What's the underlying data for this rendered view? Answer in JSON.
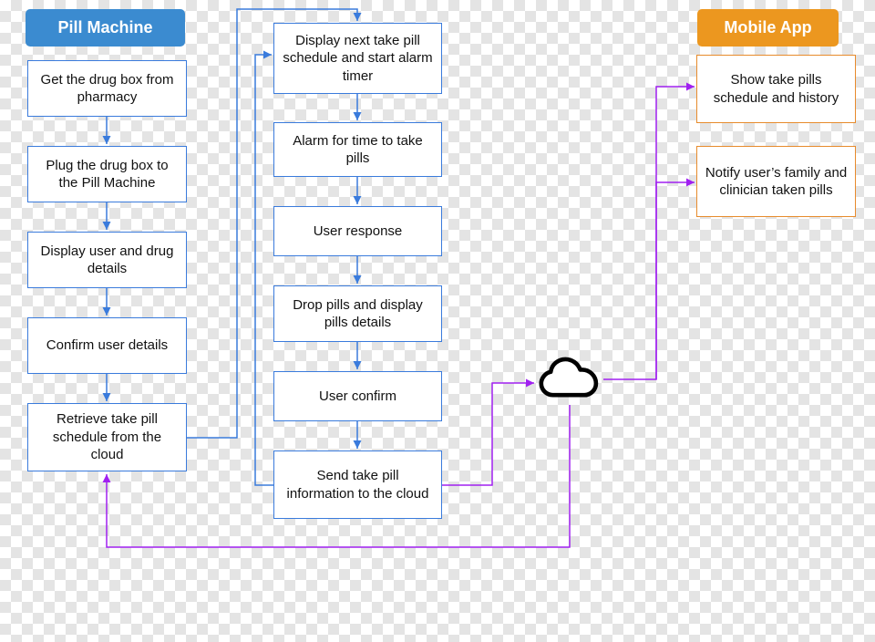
{
  "headers": {
    "pill_machine": {
      "label": "Pill Machine",
      "color": "#3b8bd0"
    },
    "mobile_app": {
      "label": "Mobile App",
      "color": "#ec971f"
    }
  },
  "col1": [
    "Get the drug box from pharmacy",
    "Plug the drug box to the Pill Machine",
    "Display user and drug details",
    "Confirm user details",
    "Retrieve take pill schedule from the cloud"
  ],
  "col2": [
    "Display next take pill schedule and start alarm timer",
    "Alarm for time to take pills",
    "User response",
    "Drop pills and display pills details",
    "User confirm",
    "Send take pill information to the cloud"
  ],
  "col3": [
    "Show take pills schedule and history",
    "Notify user’s family and clinician taken pills"
  ],
  "colors": {
    "blue_arrow": "#3a7bdc",
    "purple_arrow": "#a020f0",
    "black": "#000000"
  }
}
